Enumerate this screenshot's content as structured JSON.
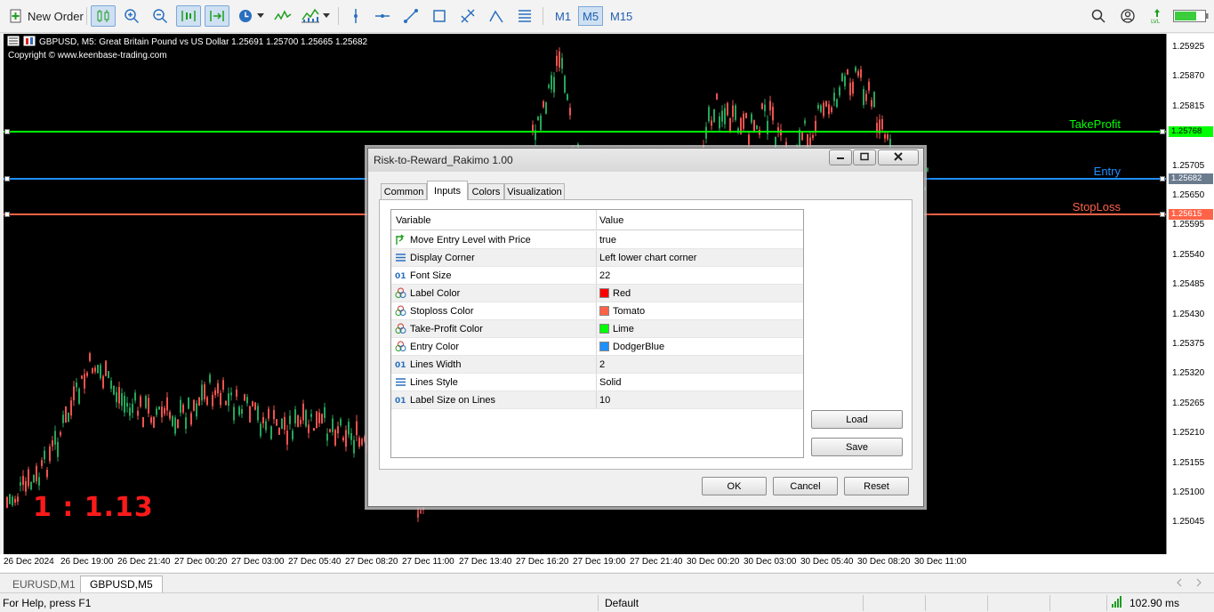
{
  "toolbar": {
    "new_order": "New Order",
    "timeframes": [
      "M1",
      "M5",
      "M15"
    ],
    "active_timeframe": "M5"
  },
  "chart": {
    "header_text": "GBPUSD, M5:  Great Britain Pound vs US Dollar  1.25691 1.25700 1.25665 1.25682",
    "copyright": "Copyright © www.keenbase-trading.com",
    "ratio_label": "1 : 1.13",
    "levels": {
      "take_profit": {
        "label": "TakeProfit",
        "price": 1.25768,
        "price_text": "1.25768",
        "color": "#00ff00"
      },
      "entry": {
        "label": "Entry",
        "price": 1.25682,
        "price_text": "1.25682",
        "color": "#1e90ff"
      },
      "stop_loss": {
        "label": "StopLoss",
        "price": 1.25615,
        "price_text": "1.25615",
        "color": "#ff6347"
      }
    },
    "price_ticks": [
      "1.25925",
      "1.25870",
      "1.25815",
      "1.25705",
      "1.25650",
      "1.25595",
      "1.25540",
      "1.25485",
      "1.25430",
      "1.25375",
      "1.25320",
      "1.25265",
      "1.25210",
      "1.25155",
      "1.25100",
      "1.25045"
    ],
    "time_ticks": [
      "26 Dec 2024",
      "26 Dec 19:00",
      "26 Dec 21:40",
      "27 Dec 00:20",
      "27 Dec 03:00",
      "27 Dec 05:40",
      "27 Dec 08:20",
      "27 Dec 11:00",
      "27 Dec 13:40",
      "27 Dec 16:20",
      "27 Dec 19:00",
      "27 Dec 21:40",
      "30 Dec 00:20",
      "30 Dec 03:00",
      "30 Dec 05:40",
      "30 Dec 08:20",
      "30 Dec 11:00"
    ]
  },
  "chart_tabs": [
    "EURUSD,M1",
    "GBPUSD,M5"
  ],
  "status": {
    "help": "For Help, press F1",
    "profile": "Default",
    "ping": "102.90 ms"
  },
  "dialog": {
    "title": "Risk-to-Reward_Rakimo 1.00",
    "tabs": [
      "Common",
      "Inputs",
      "Colors",
      "Visualization"
    ],
    "active_tab": "Inputs",
    "columns": {
      "variable": "Variable",
      "value": "Value"
    },
    "rows": [
      {
        "variable": "Move Entry Level with Price",
        "value": "true",
        "icon": "bool-arrow-icon"
      },
      {
        "variable": "Display Corner",
        "value": "Left lower chart corner",
        "icon": "enum-list-icon"
      },
      {
        "variable": "Font Size",
        "value": "22",
        "icon": "integer-icon"
      },
      {
        "variable": "Label Color",
        "value": "Red",
        "icon": "color-icon",
        "swatch": "#ff0000"
      },
      {
        "variable": "Stoploss Color",
        "value": "Tomato",
        "icon": "color-icon",
        "swatch": "#ff6347"
      },
      {
        "variable": "Take-Profit Color",
        "value": "Lime",
        "icon": "color-icon",
        "swatch": "#00ff00"
      },
      {
        "variable": "Entry Color",
        "value": "DodgerBlue",
        "icon": "color-icon",
        "swatch": "#1e90ff"
      },
      {
        "variable": "Lines Width",
        "value": "2",
        "icon": "integer-icon"
      },
      {
        "variable": "Lines Style",
        "value": "Solid",
        "icon": "enum-list-icon"
      },
      {
        "variable": "Label Size on Lines",
        "value": "10",
        "icon": "integer-icon"
      }
    ],
    "buttons": {
      "load": "Load",
      "save": "Save",
      "ok": "OK",
      "cancel": "Cancel",
      "reset": "Reset"
    }
  }
}
